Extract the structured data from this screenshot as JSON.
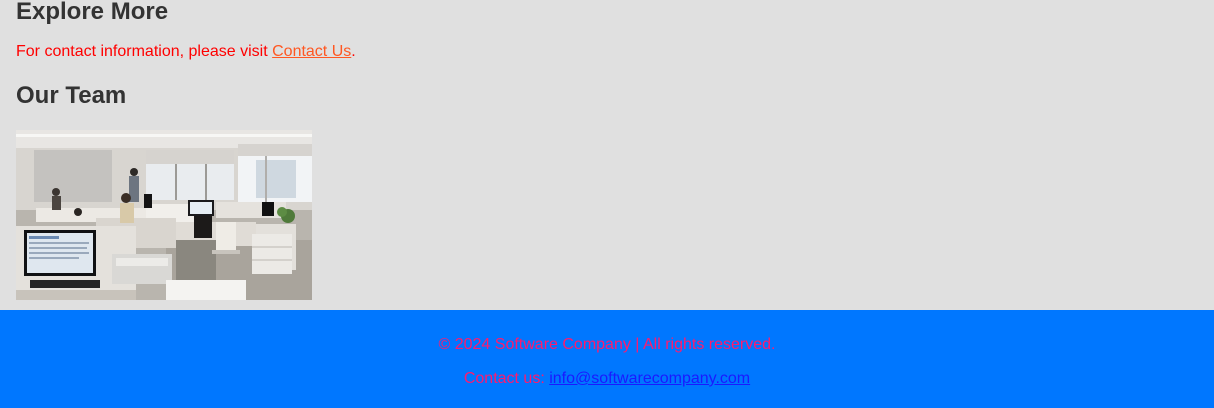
{
  "explore": {
    "heading": "Explore More",
    "text_before": "For contact information, please visit ",
    "link_label": "Contact Us",
    "text_after": "."
  },
  "team": {
    "heading": "Our Team",
    "photo_description_icon": "office-photo"
  },
  "footer": {
    "copyright": "© 2024 Software Company | All rights reserved.",
    "contact_prefix": "Contact us: ",
    "email": "info@softwarecompany.com"
  },
  "colors": {
    "page_bg": "#e0e0e0",
    "heading": "#333333",
    "body_text": "#ff0000",
    "link": "#ff5722",
    "footer_bg": "#0077ff",
    "footer_text": "#ff1a6e",
    "footer_link": "#1a1aff"
  }
}
